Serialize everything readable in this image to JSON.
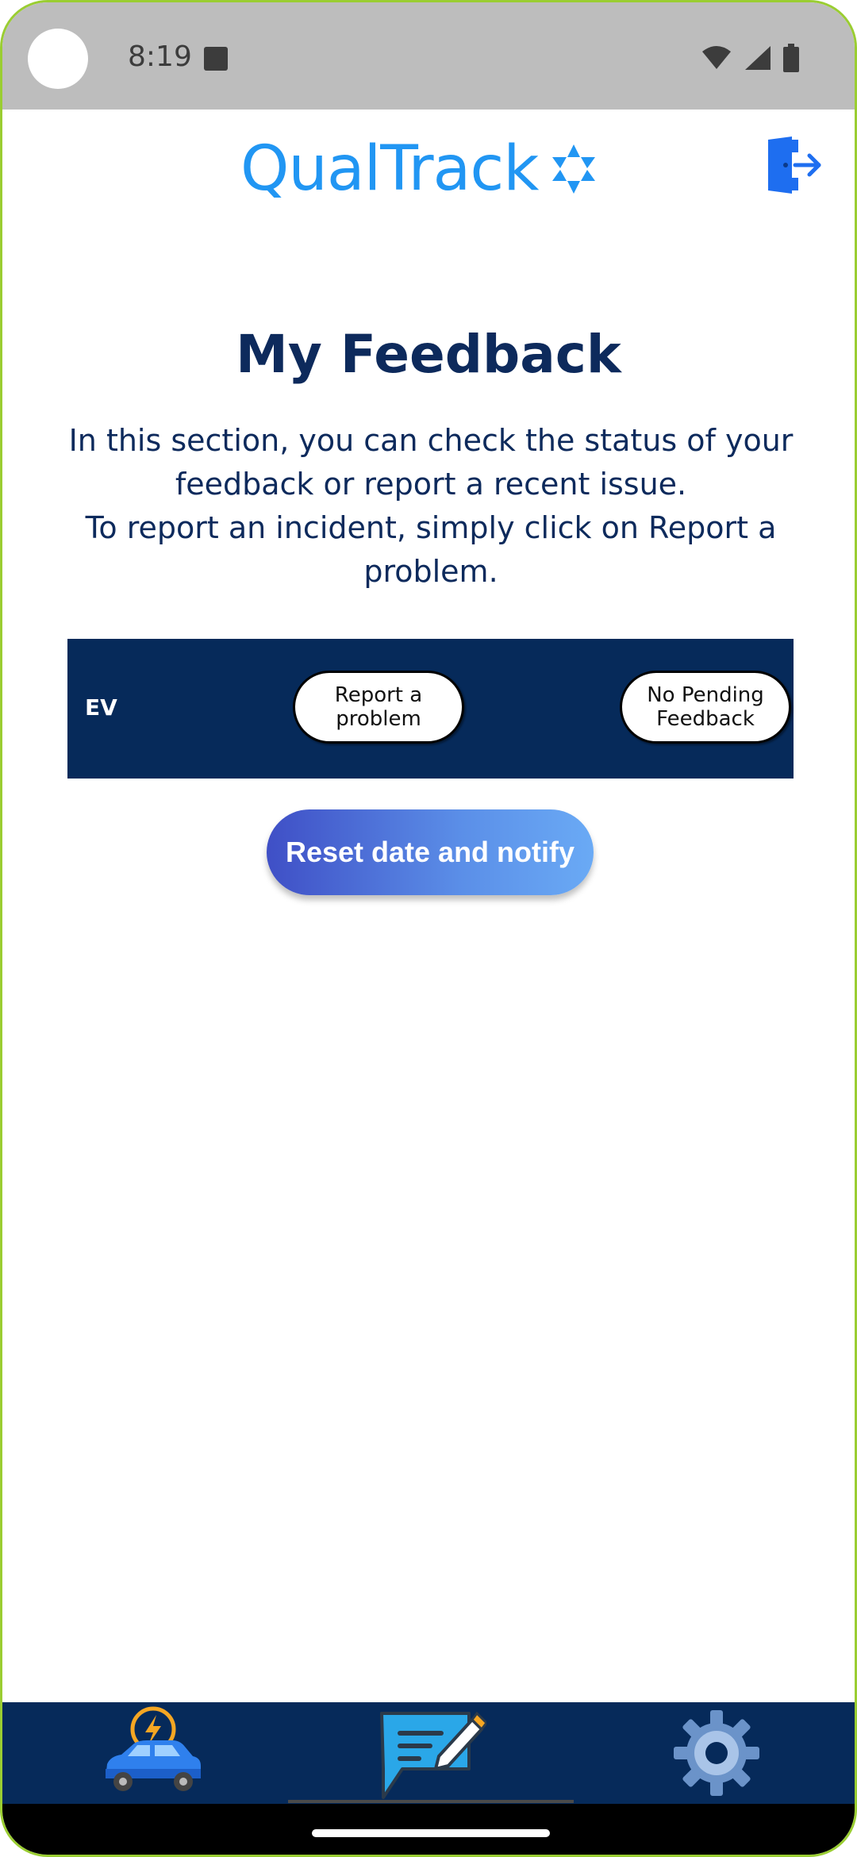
{
  "status_bar": {
    "time": "8:19"
  },
  "header": {
    "app_name": "QualTrack"
  },
  "page": {
    "title": "My Feedback",
    "description_lines": [
      "In this section, you can check the status of your feedback or report a recent issue.",
      "To report an incident, simply click on Report a problem."
    ]
  },
  "feedback_row": {
    "label": "EV",
    "report_button": "Report a problem",
    "status_button": "No Pending Feedback"
  },
  "reset_button": "Reset date and notify",
  "bottom_nav": {
    "items": [
      {
        "icon": "ev-car-icon"
      },
      {
        "icon": "feedback-message-icon",
        "active": true
      },
      {
        "icon": "gear-icon"
      }
    ]
  },
  "colors": {
    "brand_blue": "#2196f3",
    "navy": "#062a5a",
    "title_navy": "#0d2a5c",
    "status_bar_gray": "#bdbdbd"
  }
}
